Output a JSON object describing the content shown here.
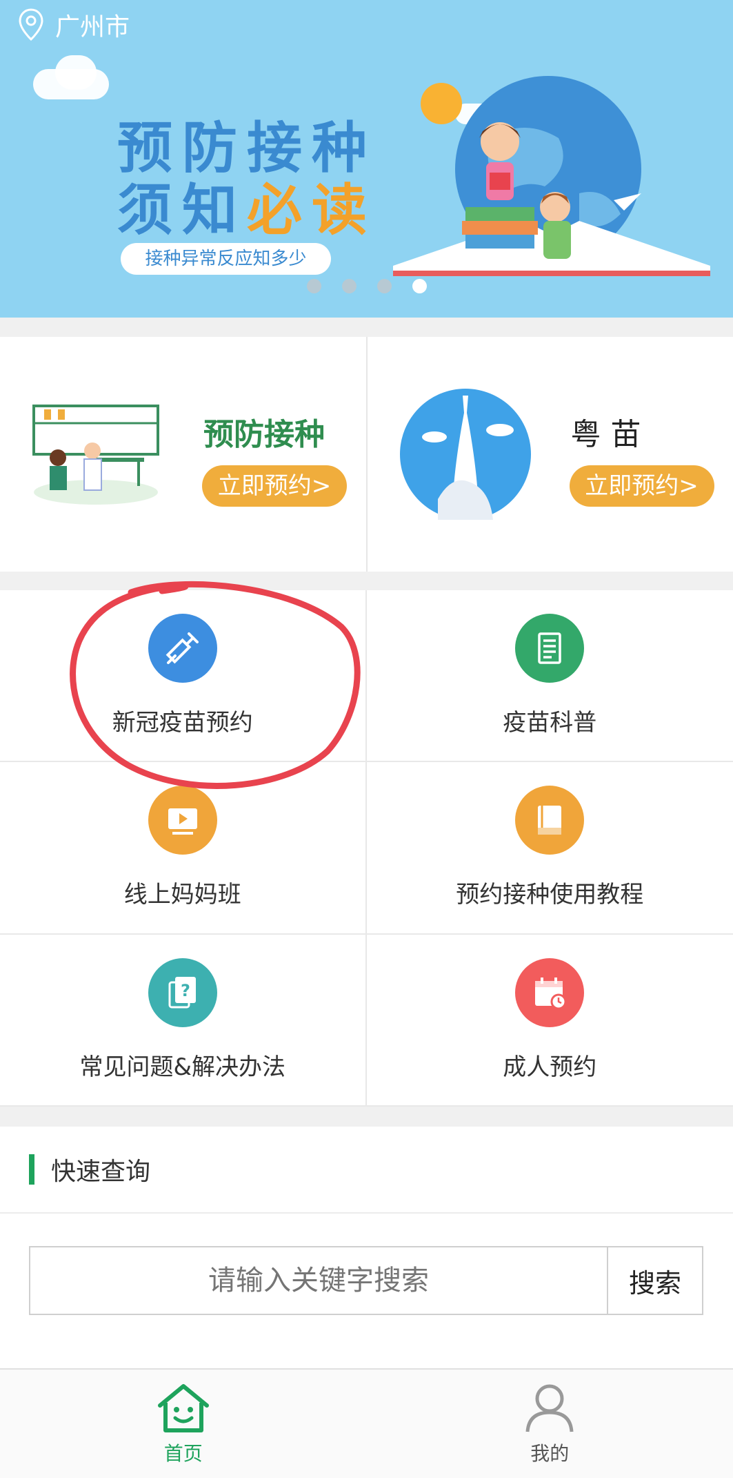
{
  "location": {
    "city": "广州市"
  },
  "banner": {
    "title_line1": "预防接种",
    "title_line2_a": "须知",
    "title_line2_b": "必读",
    "subtitle": "接种异常反应知多少",
    "dots_total": 4,
    "active_dot": 4
  },
  "cards": [
    {
      "title": "预防接种",
      "button": "立即预约>"
    },
    {
      "title": "粤 苗",
      "button": "立即预约>"
    }
  ],
  "grid": [
    {
      "label": "新冠疫苗预约",
      "icon": "syringe-icon",
      "color": "#3d8ee0"
    },
    {
      "label": "疫苗科普",
      "icon": "document-icon",
      "color": "#33a86a"
    },
    {
      "label": "线上妈妈班",
      "icon": "video-icon",
      "color": "#f0a53a"
    },
    {
      "label": "预约接种使用教程",
      "icon": "book-icon",
      "color": "#f0a53a"
    },
    {
      "label": "常见问题&解决办法",
      "icon": "question-icon",
      "color": "#3db0b0"
    },
    {
      "label": "成人预约",
      "icon": "calendar-icon",
      "color": "#f25c5c"
    }
  ],
  "quick": {
    "title": "快速查询",
    "placeholder": "请输入关键字搜索",
    "search_button": "搜索"
  },
  "tabs": [
    {
      "label": "首页",
      "active": true
    },
    {
      "label": "我的",
      "active": false
    }
  ],
  "colors": {
    "accent": "#1ea35c",
    "banner_bg": "#8fd3f2",
    "button_orange": "#f0ad3c",
    "annotation": "#e8434e"
  }
}
